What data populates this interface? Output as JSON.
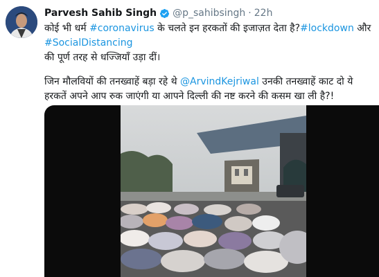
{
  "tweet": {
    "author_name": "Parvesh Sahib Singh",
    "handle": "@p_sahibsingh",
    "separator": "·",
    "time": "22h",
    "line1_a": "कोई भी धर्म ",
    "line1_link1": "#coronavirus",
    "line1_b": " के चलते इन हरकतों की इजाज़त देता है?",
    "line1_link2": "#lockdown",
    "line1_c": " और",
    "line2_link": "#SocialDistancing",
    "line3": "की पूर्ण तरह से धज्जियाँ उड़ा दीं।",
    "line4_a": "जिन मौलवियों की तनख्वाहें बड़ा रहे थे ",
    "line4_link": "@ArvindKejriwal",
    "line4_b": " उनकी तनख्वाहें काट दो ये",
    "line5": "हरकतें अपने आप रुक जाएंगी या आपने दिल्ली की नष्ट करने की कसम खा ली है?!"
  },
  "colors": {
    "link": "#1b95e0",
    "secondary_text": "#657786",
    "verified_badge": "#1da1f2"
  },
  "icons": {
    "verified": "verified-badge-icon"
  }
}
